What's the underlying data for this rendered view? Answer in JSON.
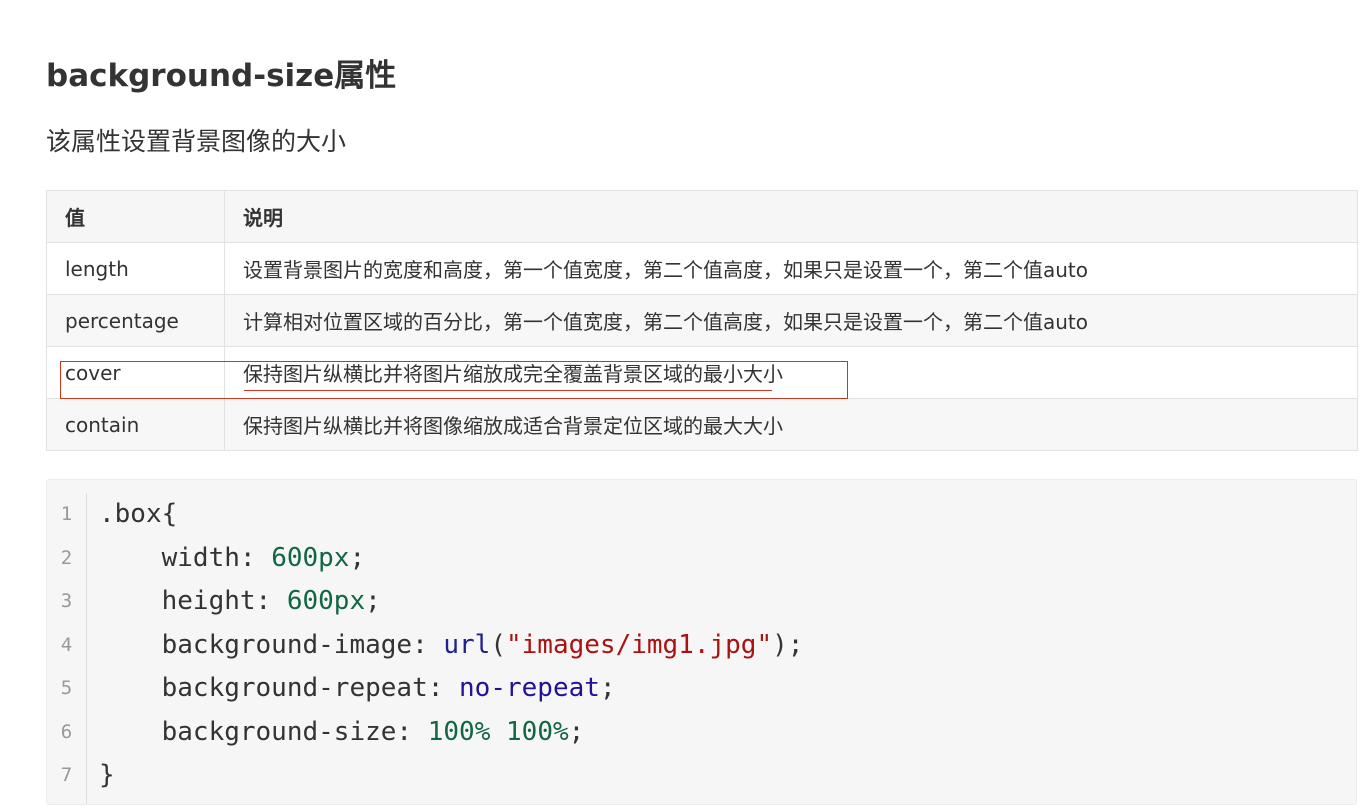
{
  "heading": "background-size属性",
  "description": "该属性设置背景图像的大小",
  "table": {
    "headers": [
      "值",
      "说明"
    ],
    "rows": [
      {
        "value": "length",
        "desc": "设置背景图片的宽度和高度，第一个值宽度，第二个值高度，如果只是设置一个，第二个值auto"
      },
      {
        "value": "percentage",
        "desc": "计算相对位置区域的百分比，第一个值宽度，第二个值高度，如果只是设置一个，第二个值auto"
      },
      {
        "value": "cover",
        "desc": "保持图片纵横比并将图片缩放成完全覆盖背景区域的最小大小"
      },
      {
        "value": "contain",
        "desc": "保持图片纵横比并将图像缩放成适合背景定位区域的最大大小"
      }
    ],
    "highlighted_row": "cover",
    "annotation_color": "#c9371e"
  },
  "code": {
    "line_numbers": [
      "1",
      "2",
      "3",
      "4",
      "5",
      "6",
      "7"
    ],
    "lines": [
      {
        "indent": "",
        "prop": ".box{",
        "sep": "",
        "tokens": []
      },
      {
        "indent": "    ",
        "prop": "width",
        "sep": ": ",
        "tokens": [
          {
            "t": "600px",
            "k": "num"
          },
          {
            "t": ";",
            "k": ""
          }
        ]
      },
      {
        "indent": "    ",
        "prop": "height",
        "sep": ": ",
        "tokens": [
          {
            "t": "600px",
            "k": "num"
          },
          {
            "t": ";",
            "k": ""
          }
        ]
      },
      {
        "indent": "    ",
        "prop": "background-image",
        "sep": ": ",
        "tokens": [
          {
            "t": "url",
            "k": "fn"
          },
          {
            "t": "(",
            "k": ""
          },
          {
            "t": "\"images/img1.jpg\"",
            "k": "str"
          },
          {
            "t": ");",
            "k": ""
          }
        ]
      },
      {
        "indent": "    ",
        "prop": "background-repeat",
        "sep": ": ",
        "tokens": [
          {
            "t": "no-repeat",
            "k": "kw"
          },
          {
            "t": ";",
            "k": ""
          }
        ]
      },
      {
        "indent": "    ",
        "prop": "background-size",
        "sep": ": ",
        "tokens": [
          {
            "t": "100%",
            "k": "num"
          },
          {
            "t": " ",
            "k": ""
          },
          {
            "t": "100%",
            "k": "num"
          },
          {
            "t": ";",
            "k": ""
          }
        ]
      },
      {
        "indent": "",
        "prop": "}",
        "sep": "",
        "tokens": []
      }
    ],
    "colors": {
      "num": "#116644",
      "fn": "#22228a",
      "str": "#aa1111",
      "kw": "#221199"
    }
  }
}
